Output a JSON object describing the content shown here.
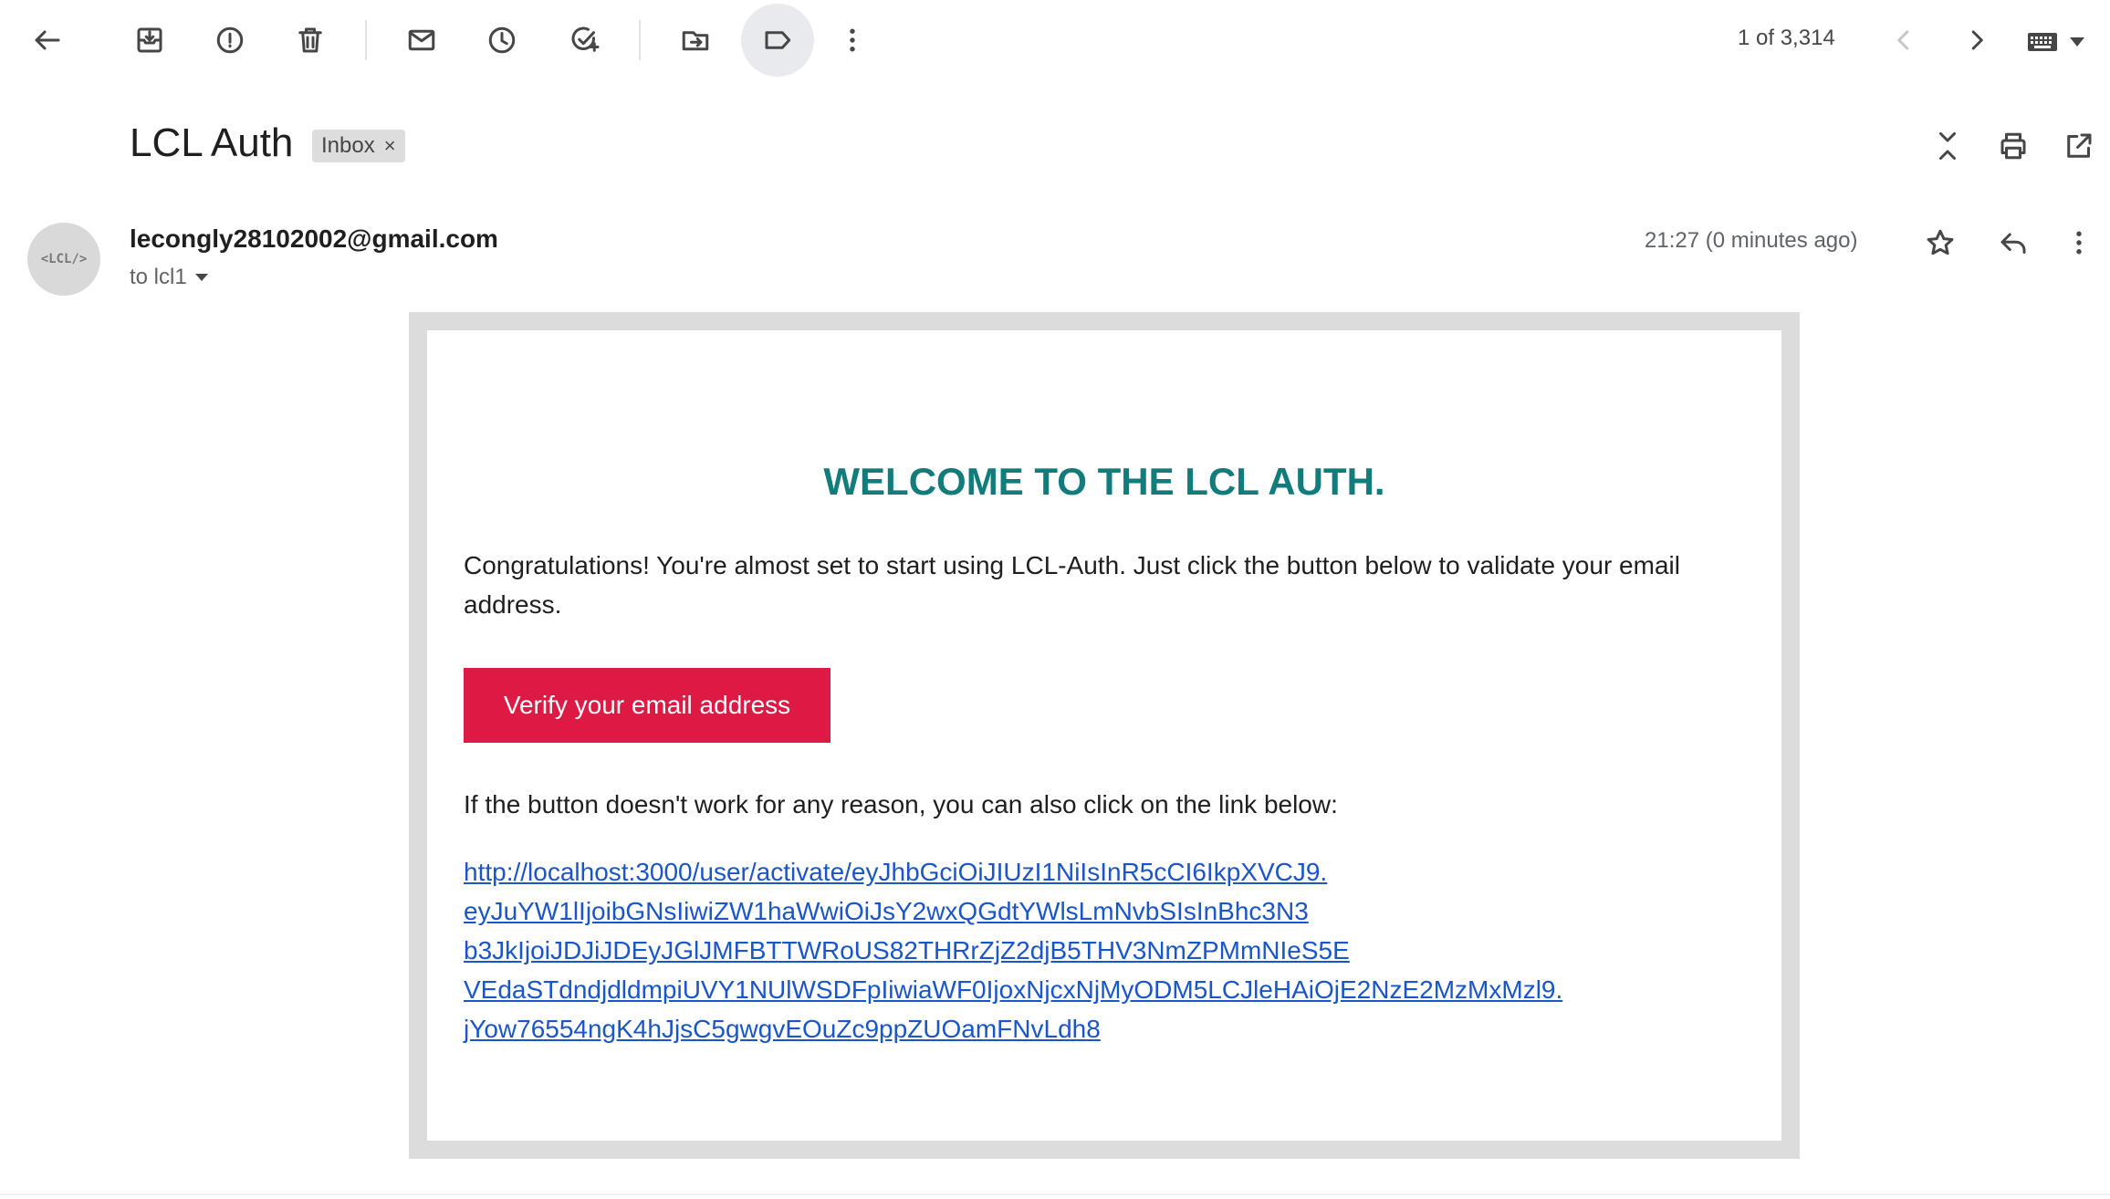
{
  "toolbar": {
    "back": "back-arrow-icon",
    "archive": "archive-icon",
    "report_spam": "report-spam-icon",
    "delete": "trash-icon",
    "mark_unread": "mail-icon",
    "snooze": "clock-icon",
    "add_task": "add-task-icon",
    "move_to": "move-to-folder-icon",
    "labels": "label-icon",
    "more": "more-vert-icon"
  },
  "pager": {
    "count": "1 of 3,314"
  },
  "email": {
    "subject": "LCL Auth",
    "label": "Inbox",
    "label_remove": "×",
    "sender": "lecongly28102002@gmail.com",
    "avatar_text": "<LCL/>",
    "to": "to lcl1",
    "timestamp": "21:27 (0 minutes ago)"
  },
  "body": {
    "heading": "WELCOME TO THE LCL AUTH.",
    "intro_line1": "Congratulations! You're almost set to start using LCL-Auth. Just click the button below to validate your email",
    "intro_line2": "address.",
    "button_label": "Verify your email address",
    "fallback_text": "If the button doesn't work for any reason, you can also click on the link below:",
    "link_lines": [
      "http://localhost:3000/user/activate/eyJhbGciOiJIUzI1NiIsInR5cCI6IkpXVCJ9.",
      "eyJuYW1lIjoibGNsIiwiZW1haWwiOiJsY2wxQGdtYWlsLmNvbSIsInBhc3N3",
      "b3JkIjoiJDJiJDEyJGlJMFBTTWRoUS82THRrZjZ2djB5THV3NmZPMmNIeS5E",
      "VEdaSTdndjdldmpiUVY1NUlWSDFpIiwiaWF0IjoxNjcxNjMyODM5LCJleHAiOjE2NzE2MzMxMzl9.",
      "jYow76554ngK4hJjsC5gwgvEOuZc9ppZUOamFNvLdh8"
    ]
  },
  "colors": {
    "heading": "#127c7c",
    "button": "#dc1a44",
    "link": "#1a56c9"
  }
}
